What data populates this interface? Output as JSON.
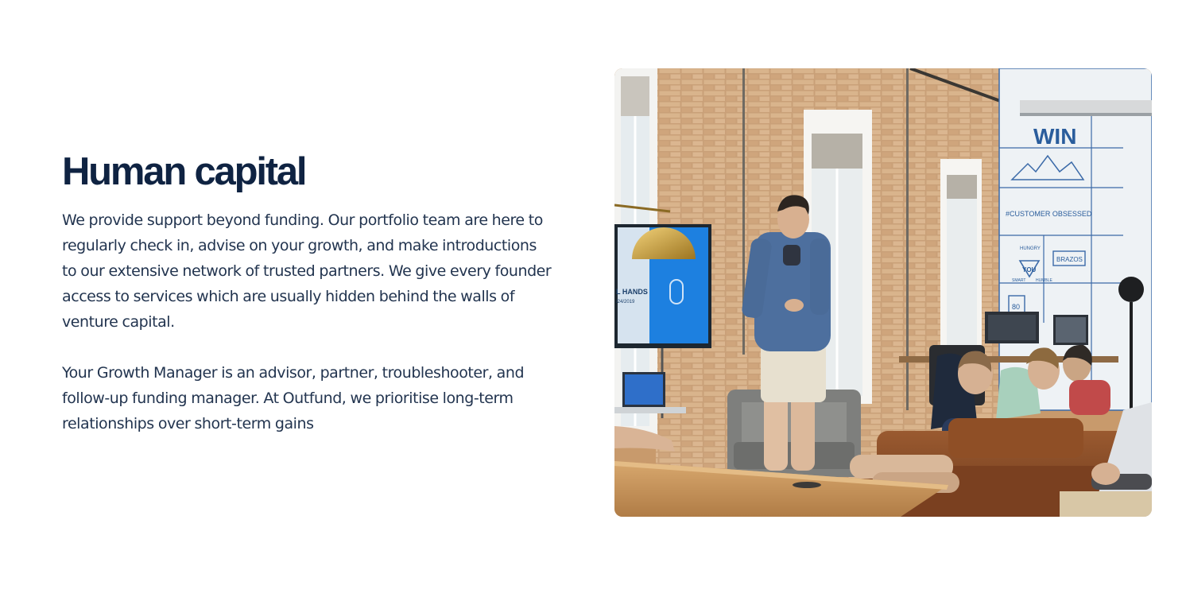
{
  "section": {
    "title": "Human capital",
    "paragraphs": [
      "We provide support beyond funding. Our portfolio team are here to regularly check in, advise on your growth, and make introductions to our extensive network of trusted partners. We give every founder access to services which are usually hidden behind the walls of venture capital.",
      "Your Growth Manager is an advisor, partner, troubleshooter, and follow-up funding manager. At Outfund, we prioritise long-term relationships over short-term gains"
    ]
  },
  "photo": {
    "screen_text": "L HANDS",
    "screen_date": "/24/2019",
    "mural_texts": [
      "WIN",
      "#CUSTOMER OBSESSED",
      "HUNGRY",
      "YOU",
      "SMART",
      "HUMBLE",
      "BRAZOS",
      "80"
    ]
  },
  "colors": {
    "heading": "#0f2342",
    "body_text": "#22344f",
    "background": "#ffffff"
  }
}
